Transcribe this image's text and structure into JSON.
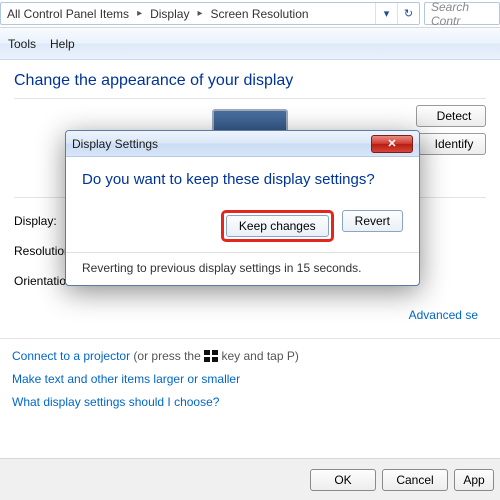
{
  "breadcrumbs": {
    "c1": "All Control Panel Items",
    "c2": "Display",
    "c3": "Screen Resolution"
  },
  "search": {
    "placeholder": "Search Contr"
  },
  "menu": {
    "tools": "Tools",
    "help": "Help"
  },
  "page_title": "Change the appearance of your display",
  "side": {
    "detect": "Detect",
    "identify": "Identify"
  },
  "labels": {
    "display": "Display:",
    "resolution": "Resolution:",
    "orientation": "Orientation:"
  },
  "advanced_link": "Advanced se",
  "footer": {
    "projector_link": "Connect to a projector",
    "projector_rest": " (or press the ",
    "projector_tail": " key and tap P)",
    "text_size": "Make text and other items larger or smaller",
    "what_settings": "What display settings should I choose?"
  },
  "bottom": {
    "ok": "OK",
    "cancel": "Cancel",
    "apply": "App"
  },
  "dialog": {
    "title": "Display Settings",
    "close_glyph": "✕",
    "heading": "Do you want to keep these display settings?",
    "keep": "Keep changes",
    "revert": "Revert",
    "status": "Reverting to previous display settings in 15 seconds."
  }
}
